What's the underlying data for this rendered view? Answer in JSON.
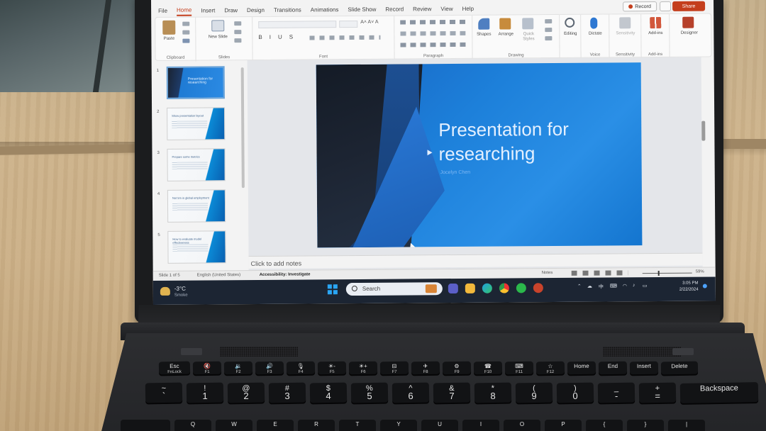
{
  "powerpoint": {
    "ribbon_tabs": [
      "File",
      "Home",
      "Insert",
      "Draw",
      "Design",
      "Transitions",
      "Animations",
      "Slide Show",
      "Record",
      "Review",
      "View",
      "Help"
    ],
    "active_tab": "Home",
    "record_label": "Record",
    "share_label": "Share",
    "ribbon_groups": {
      "clipboard": "Clipboard",
      "slides": "Slides",
      "font": "Font",
      "paragraph": "Paragraph",
      "drawing": "Drawing",
      "voice": "Voice",
      "sensitivity": "Sensitivity",
      "addins": "Add-ins"
    },
    "ribbon_buttons": {
      "paste": "Paste",
      "new_slide": "New Slide",
      "shapes": "Shapes",
      "arrange": "Arrange",
      "quick_styles": "Quick Styles",
      "editing": "Editing",
      "dictate": "Dictate",
      "sensitivity": "Sensitivity",
      "addins": "Add-ins",
      "designer": "Designer"
    },
    "font_buttons": [
      "B",
      "I",
      "U",
      "S"
    ],
    "thumbnails": [
      {
        "number": "1",
        "title": "Presentation for researching",
        "selected": true
      },
      {
        "number": "2",
        "title": "Show presentation layout",
        "selected": false
      },
      {
        "number": "3",
        "title": "Prepare some metrics",
        "selected": false
      },
      {
        "number": "4",
        "title": "Not 5m in global employment",
        "selected": false
      },
      {
        "number": "5",
        "title": "How to evaluate model effectiveness",
        "selected": false
      }
    ],
    "slide": {
      "title_line1": "Presentation for",
      "title_line2": "researching",
      "subtitle": "Jocelyn Chen"
    },
    "notes_placeholder": "Click to add notes",
    "status": {
      "slide_indicator": "Slide 1 of 5",
      "language": "English (United States)",
      "accessibility": "Accessibility: Investigate",
      "notes": "Notes",
      "zoom": "59%"
    }
  },
  "taskbar": {
    "weather_temp": "-3°C",
    "weather_desc": "Smoke",
    "search_placeholder": "Search",
    "tray_ime": "中",
    "clock_time": "3:05 PM",
    "clock_date": "2/22/2024"
  },
  "keyboard": {
    "fn_row": [
      {
        "top": "Esc",
        "bottom": "FnLock"
      },
      {
        "top": "🔇",
        "bottom": "F1"
      },
      {
        "top": "🔉",
        "bottom": "F2"
      },
      {
        "top": "🔊",
        "bottom": "F3"
      },
      {
        "top": "🎙",
        "bottom": "F4"
      },
      {
        "top": "☀-",
        "bottom": "F5"
      },
      {
        "top": "☀+",
        "bottom": "F6"
      },
      {
        "top": "⊟",
        "bottom": "F7"
      },
      {
        "top": "✈",
        "bottom": "F8"
      },
      {
        "top": "⚙",
        "bottom": "F9"
      },
      {
        "top": "☎",
        "bottom": "F10"
      },
      {
        "top": "⌨",
        "bottom": "F11"
      },
      {
        "top": "☆",
        "bottom": "F12"
      },
      {
        "top": "Home",
        "bottom": ""
      },
      {
        "top": "End",
        "bottom": ""
      },
      {
        "top": "Insert",
        "bottom": ""
      },
      {
        "top": "Delete",
        "bottom": ""
      }
    ],
    "number_row": [
      {
        "top": "~",
        "bottom": "`"
      },
      {
        "top": "!",
        "bottom": "1"
      },
      {
        "top": "@",
        "bottom": "2"
      },
      {
        "top": "#",
        "bottom": "3"
      },
      {
        "top": "$",
        "bottom": "4"
      },
      {
        "top": "%",
        "bottom": "5"
      },
      {
        "top": "^",
        "bottom": "6"
      },
      {
        "top": "&",
        "bottom": "7"
      },
      {
        "top": "*",
        "bottom": "8"
      },
      {
        "top": "(",
        "bottom": "9"
      },
      {
        "top": ")",
        "bottom": "0"
      },
      {
        "top": "_",
        "bottom": "-"
      },
      {
        "top": "+",
        "bottom": "="
      },
      {
        "top": "Backspace",
        "bottom": ""
      }
    ],
    "row3_partial": [
      "",
      "Q",
      "W",
      "E",
      "R",
      "T",
      "Y",
      "U",
      "I",
      "O",
      "P",
      "{",
      "}",
      "|"
    ]
  }
}
